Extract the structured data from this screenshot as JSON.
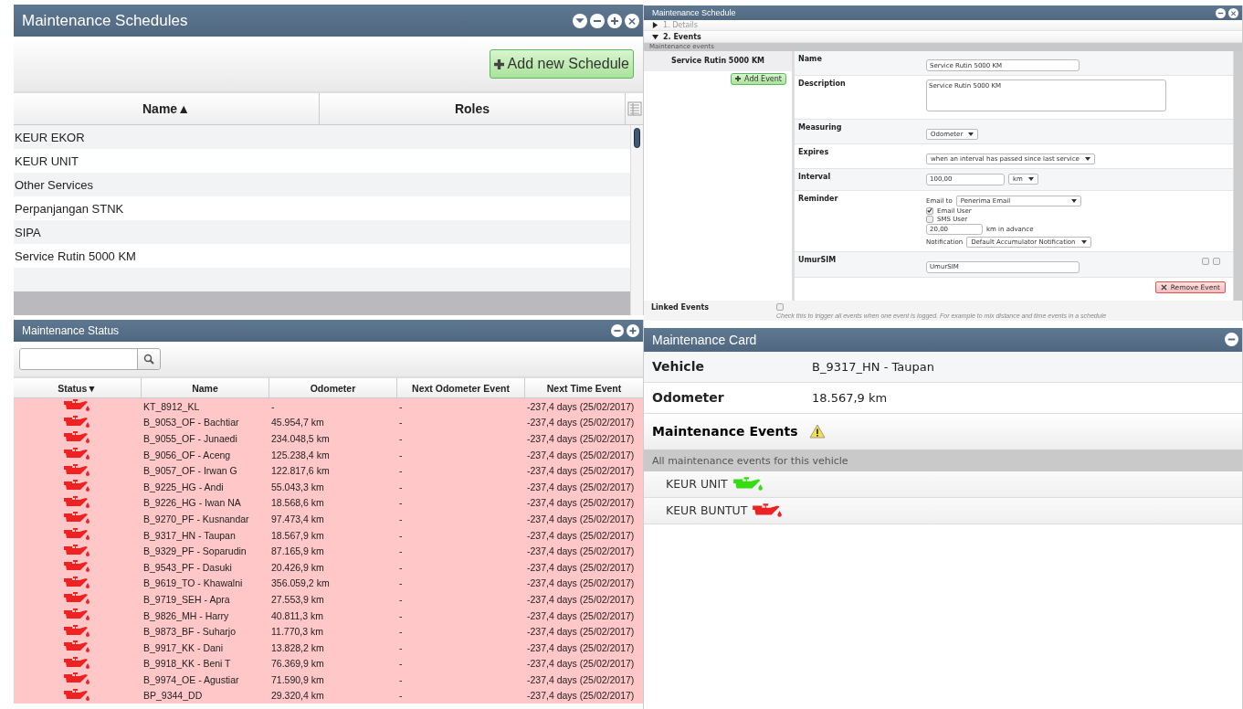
{
  "schedules": {
    "title": "Maintenance Schedules",
    "add_button": "Add new Schedule",
    "columns": [
      "Name▲",
      "Roles"
    ],
    "rows": [
      {
        "name": "KEUR EKOR"
      },
      {
        "name": "KEUR UNIT"
      },
      {
        "name": "Other Services"
      },
      {
        "name": "Perpanjangan STNK"
      },
      {
        "name": "SIPA"
      },
      {
        "name": "Service Rutin 5000 KM"
      }
    ]
  },
  "editor": {
    "title": "Maintenance Schedule",
    "sections": [
      {
        "label": "1. Details",
        "expanded": false
      },
      {
        "label": "2. Events",
        "expanded": true
      }
    ],
    "events_header": "Maintenance events",
    "events": [
      {
        "name": "Service Rutin 5000 KM",
        "selected": true
      }
    ],
    "add_event": "Add Event",
    "fields": [
      {
        "kind": "text",
        "label": "Name",
        "value": "Service Rutin 5000 KM"
      },
      {
        "kind": "textarea",
        "label": "Description",
        "value": "Service Rutin 5000 KM"
      },
      {
        "kind": "select",
        "label": "Measuring",
        "value": "Odometer"
      },
      {
        "kind": "select",
        "label": "Expires",
        "value": "when an interval has passed since last service"
      },
      {
        "kind": "interval",
        "label": "Interval",
        "value": "100,00",
        "unit": "km"
      },
      {
        "kind": "reminder",
        "label": "Reminder",
        "email_to_label": "Email to",
        "email_to_value": "Penerima Email",
        "options": [
          {
            "label": "Email User",
            "checked": true
          },
          {
            "label": "SMS User",
            "checked": false
          }
        ],
        "advance_value": "20,00",
        "advance_label": "km in advance",
        "notification_label": "Notification",
        "notification_value": "Default Accumulator Notification"
      },
      {
        "kind": "custom",
        "label": "UmurSIM",
        "value": "UmurSIM"
      }
    ],
    "remove_button": "Remove Event",
    "linked": {
      "label": "Linked Events",
      "checked": false,
      "hint": "Check this to trigger all events when one event is logged. For example to mix distance and time events in a schedule"
    }
  },
  "status": {
    "title": "Maintenance Status",
    "columns": [
      "Status▼",
      "Name",
      "Odometer",
      "Next Odometer Event",
      "Next Time Event"
    ],
    "rows": [
      {
        "color": "#ee2222",
        "name": "KT_8912_KL",
        "odometer": "-",
        "next_odometer": "-",
        "next_time": "-237,4 days (25/02/2017)"
      },
      {
        "color": "#ee2222",
        "name": "B_9053_OF - Bachtiar",
        "odometer": "45.954,7 km",
        "next_odometer": "-",
        "next_time": "-237,4 days (25/02/2017)"
      },
      {
        "color": "#ee2222",
        "name": "B_9055_OF - Junaedi",
        "odometer": "234.048,5 km",
        "next_odometer": "-",
        "next_time": "-237,4 days (25/02/2017)"
      },
      {
        "color": "#ee2222",
        "name": "B_9056_OF - Aceng",
        "odometer": "125.238,4 km",
        "next_odometer": "-",
        "next_time": "-237,4 days (25/02/2017)"
      },
      {
        "color": "#ee2222",
        "name": "B_9057_OF - Irwan G",
        "odometer": "122.817,6 km",
        "next_odometer": "-",
        "next_time": "-237,4 days (25/02/2017)"
      },
      {
        "color": "#ee2222",
        "name": "B_9225_HG - Andi",
        "odometer": "55.043,3 km",
        "next_odometer": "-",
        "next_time": "-237,4 days (25/02/2017)"
      },
      {
        "color": "#ee2222",
        "name": "B_9226_HG - Iwan NA",
        "odometer": "18.568,6 km",
        "next_odometer": "-",
        "next_time": "-237,4 days (25/02/2017)"
      },
      {
        "color": "#ee2222",
        "name": "B_9270_PF - Kusnandar",
        "odometer": "97.473,4 km",
        "next_odometer": "-",
        "next_time": "-237,4 days (25/02/2017)"
      },
      {
        "color": "#ee2222",
        "name": "B_9317_HN - Taupan",
        "odometer": "18.567,9 km",
        "next_odometer": "-",
        "next_time": "-237,4 days (25/02/2017)"
      },
      {
        "color": "#ee2222",
        "name": "B_9329_PF - Soparudin",
        "odometer": "87.165,9 km",
        "next_odometer": "-",
        "next_time": "-237,4 days (25/02/2017)"
      },
      {
        "color": "#ee2222",
        "name": "B_9543_PF - Dasuki",
        "odometer": "20.426,9 km",
        "next_odometer": "-",
        "next_time": "-237,4 days (25/02/2017)"
      },
      {
        "color": "#ee2222",
        "name": "B_9619_TO - Khawalni",
        "odometer": "356.059,2 km",
        "next_odometer": "-",
        "next_time": "-237,4 days (25/02/2017)"
      },
      {
        "color": "#ee2222",
        "name": "B_9719_SEH - Apra",
        "odometer": "27.553,9 km",
        "next_odometer": "-",
        "next_time": "-237,4 days (25/02/2017)"
      },
      {
        "color": "#ee2222",
        "name": "B_9826_MH - Harry",
        "odometer": "40.811,3 km",
        "next_odometer": "-",
        "next_time": "-237,4 days (25/02/2017)"
      },
      {
        "color": "#ee2222",
        "name": "B_9873_BF - Suharjo",
        "odometer": "11.770,3 km",
        "next_odometer": "-",
        "next_time": "-237,4 days (25/02/2017)"
      },
      {
        "color": "#ee2222",
        "name": "B_9917_KK - Dani",
        "odometer": "13.828,2 km",
        "next_odometer": "-",
        "next_time": "-237,4 days (25/02/2017)"
      },
      {
        "color": "#ee2222",
        "name": "B_9918_KK - Beni T",
        "odometer": "76.369,9 km",
        "next_odometer": "-",
        "next_time": "-237,4 days (25/02/2017)"
      },
      {
        "color": "#ee2222",
        "name": "B_9974_OE - Agustiar",
        "odometer": "71.590,9 km",
        "next_odometer": "-",
        "next_time": "-237,4 days (25/02/2017)"
      },
      {
        "color": "#ee2222",
        "name": "BP_9344_DD",
        "odometer": "29.320,4 km",
        "next_odometer": "-",
        "next_time": "-237,4 days (25/02/2017)"
      }
    ]
  },
  "card": {
    "title": "Maintenance Card",
    "fields": [
      {
        "label": "Vehicle",
        "value": "B_9317_HN - Taupan"
      },
      {
        "label": "Odometer",
        "value": "18.567,9 km"
      }
    ],
    "events_title": "Maintenance Events",
    "events_hint": "All maintenance events for this vehicle",
    "events": [
      {
        "name": "KEUR UNIT",
        "color": "#33dd11"
      },
      {
        "name": "KEUR BUNTUT",
        "color": "#ee2222"
      }
    ]
  }
}
